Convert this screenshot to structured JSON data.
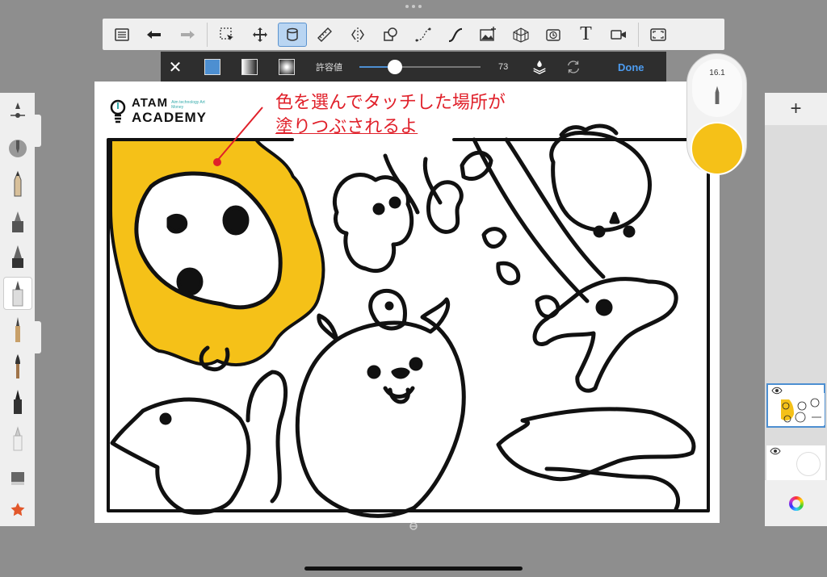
{
  "toolbar": {
    "items": [
      {
        "name": "list-icon"
      },
      {
        "name": "undo-icon"
      },
      {
        "name": "redo-icon"
      },
      {
        "name": "selection-icon"
      },
      {
        "name": "move-icon"
      },
      {
        "name": "fill-bucket-icon",
        "active": true
      },
      {
        "name": "ruler-icon"
      },
      {
        "name": "symmetry-icon"
      },
      {
        "name": "shapes-icon"
      },
      {
        "name": "curve-icon"
      },
      {
        "name": "stroke-icon"
      },
      {
        "name": "image-import-icon"
      },
      {
        "name": "perspective-icon"
      },
      {
        "name": "time-icon"
      },
      {
        "name": "text-icon"
      },
      {
        "name": "video-icon"
      },
      {
        "name": "fullscreen-icon"
      }
    ],
    "text_label": "T"
  },
  "fill_bar": {
    "close_label": "✕",
    "tolerance_label": "許容値",
    "tolerance_value": "73",
    "tolerance_fraction": 0.73,
    "done_label": "Done",
    "solid_color": "#4d8fd1"
  },
  "brush_size": "16.1",
  "current_color": "#f5c118",
  "canvas": {
    "logo_top": "ATAM",
    "logo_sub": "Aim technology Art Money",
    "logo_bottom": "ACADEMY",
    "annotation_line1": "色を選んでタッチした場所が",
    "annotation_line2": "塗りつぶされるよ",
    "annotation_color": "#e0202a",
    "fill_color": "#f5c118"
  },
  "layers": {
    "add_label": "+",
    "items": [
      {
        "name": "drawing-layer",
        "selected": true
      },
      {
        "name": "blank-layer",
        "selected": false
      }
    ]
  }
}
